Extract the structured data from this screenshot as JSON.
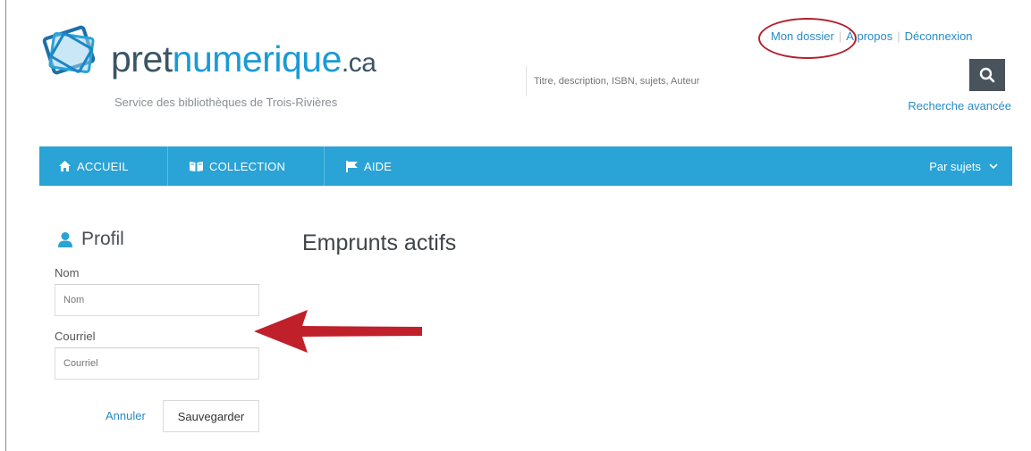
{
  "brand": {
    "name_part1": "pret",
    "name_part2": "numerique",
    "name_part3": ".ca",
    "tagline": "Service des bibliothèques de Trois-Rivières",
    "colors": {
      "dark": "#3a5563",
      "accent": "#1a9ad6"
    }
  },
  "header": {
    "links": [
      "Mon dossier",
      "À propos",
      "Déconnexion"
    ],
    "search_placeholder": "Titre, description, ISBN, sujets, Auteur",
    "search_icon": "search-icon",
    "advanced_search": "Recherche avancée"
  },
  "nav": {
    "items": [
      {
        "label": "ACCUEIL",
        "icon": "home-icon"
      },
      {
        "label": "COLLECTION",
        "icon": "book-icon"
      },
      {
        "label": "AIDE",
        "icon": "flag-icon"
      }
    ],
    "subjects": "Par sujets",
    "subjects_icon": "chevron-down-icon",
    "color": "#2aa3d6"
  },
  "profile": {
    "title": "Profil",
    "icon": "user-icon",
    "name_label": "Nom",
    "name_placeholder": "Nom",
    "email_label": "Courriel",
    "email_placeholder": "Courriel",
    "cancel": "Annuler",
    "save": "Sauvegarder"
  },
  "main": {
    "title": "Emprunts actifs"
  },
  "annotations": {
    "highlight_color": "#b3212b",
    "arrow_color": "#c0202a"
  }
}
